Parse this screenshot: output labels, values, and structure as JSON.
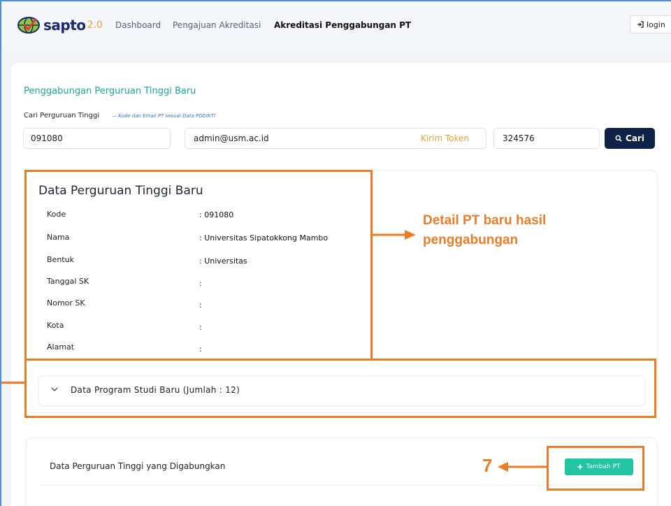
{
  "navbar": {
    "logo_text": "sapto",
    "logo_version": "2.0",
    "items": [
      "Dashboard",
      "Pengajuan Akreditasi",
      "Akreditasi Penggabungan PT"
    ],
    "login_label": "login"
  },
  "search": {
    "section_title": "Penggabungan Perguruan Tinggi Baru",
    "label": "Cari Perguruan Tinggi",
    "hint": "— Kode dan Email PT sesuai Data PDDIKTI",
    "kode_value": "091080",
    "email_value": "admin@usm.ac.id",
    "token_link": "Kirim Token",
    "token_value": "324576",
    "cari_label": "Cari"
  },
  "detail": {
    "title": "Data Perguruan Tinggi Baru",
    "rows": [
      {
        "label": "Kode",
        "value": ": 091080"
      },
      {
        "label": "Nama",
        "value": ": Universitas Sipatokkong Mambo"
      },
      {
        "label": "Bentuk",
        "value": ": Universitas"
      },
      {
        "label": "Tanggal SK",
        "value": ":"
      },
      {
        "label": "Nomor SK",
        "value": ":"
      },
      {
        "label": "Kota",
        "value": ":"
      },
      {
        "label": "Alamat",
        "value": ":"
      }
    ],
    "prodi_accordion": "Data Program Studi Baru (Jumlah : 12)"
  },
  "merged": {
    "title": "Data Perguruan Tinggi yang Digabungkan",
    "add_button": "Tambah PT"
  },
  "annotations": {
    "detail_callout_line1": "Detail PT baru hasil",
    "detail_callout_line2": "penggabungan",
    "step_number": "7",
    "color": "#ea7d2a"
  },
  "colors": {
    "primary_dark": "#0f2248",
    "teal": "#1aa79a",
    "green_button": "#22c5a1",
    "orange": "#e7a23a"
  }
}
